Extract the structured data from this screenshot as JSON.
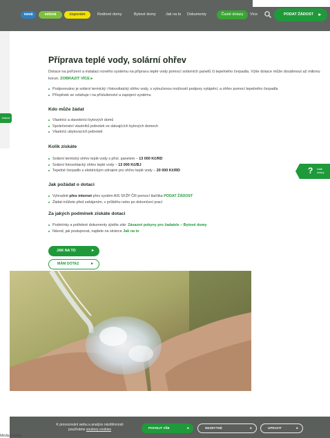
{
  "header": {
    "pills": [
      "nová",
      "zelená",
      "úsporám"
    ],
    "nav": [
      "Rodinné domy",
      "Bytové domy",
      "Jak na to",
      "Dokumenty"
    ],
    "faq_label": "Časté dotazy",
    "faq_suffix": "Více",
    "apply_label": "PODAT ŽÁDOST",
    "arrow": "▸"
  },
  "side": {
    "left_tab": "žádost",
    "help_q": "?",
    "help_text": "Další dotazy"
  },
  "article": {
    "title": "Příprava teplé vody, solární ohřev",
    "intro": "Dotace na pořízení a instalaci nového systému na přípravu teplé vody pomocí solárních panelů či tepelného čerpadla. Výše dotace může dosáhnout až milionu korun.",
    "intro_link": "ZOBRAZIT VÍCE ▸",
    "bullets1": [
      "Podporováno je solární termický i fotovoltaický ohřev vody, s vyloučenou možností podpory vytápění, a ohřev pomocí tepelného čerpadla",
      "Příspěvek se vztahuje i na příslušenství a zapojení systému"
    ],
    "who_title": "Kdo může žádat",
    "who_items": [
      "Vlastníci a stavebníci bytových domů",
      "Společenství vlastníků jednotek ve stávajících bytových domech",
      "Vlastníci ubytovacích jednotek"
    ],
    "how_much_title": "Kolik získáte",
    "how_much_items": [
      {
        "text": "Solární termický ohřev teplé vody s přísl. panelem – ",
        "amount": "13 000 Kč/RD"
      },
      {
        "text": "Solární fotovoltaický ohřev teplé vody – ",
        "amount": "13 000 Kč/BJ"
      },
      {
        "text": "Tepelné čerpadlo s elektrickým zdrojem pro ohřev teplé vody – ",
        "amount": "20 000 Kč/RD"
      }
    ],
    "how_title": "Jak požádat o dotaci",
    "how_items": [
      {
        "pre": "Vyhradně ",
        "bold": "přes internet",
        "mid": " přes systém AIS SFŽP ČR pomocí tlačítka ",
        "link": "PODAT ŽÁDOST"
      },
      {
        "pre": "Žádat můžete před zahájením, v průběhu nebo po dokončení prací",
        "bold": "",
        "mid": "",
        "link": ""
      }
    ],
    "conditions_title": "Za jakých podmínek získáte dotaci",
    "conditions_items": [
      {
        "pre": "Podmínky a potřebné dokumenty zjistíte zde: ",
        "link": "Závazné pokyny pro žadatele – Bytové domy"
      },
      {
        "pre": "Návod, jak postupovat, najdete na stránce ",
        "link": "Jak na to"
      }
    ],
    "btn_primary": "JAK NA TO",
    "btn_secondary": "MÁM DOTAZ"
  },
  "cookies": {
    "text_1": "K provozování webu a analýze návštěvnosti",
    "text_2": "používáme",
    "text_link": "soubory cookies",
    "allow": "POVOLIT VŠE",
    "necessary": "NEZBYTNÉ",
    "settings": "UPRAVIT"
  },
  "bottom_crop": "Média o tomto",
  "colors": {
    "brand_green": "#1f9a3a",
    "header_grey": "#5e6360",
    "blue": "#2f7fc1",
    "yellow": "#f2e200"
  }
}
